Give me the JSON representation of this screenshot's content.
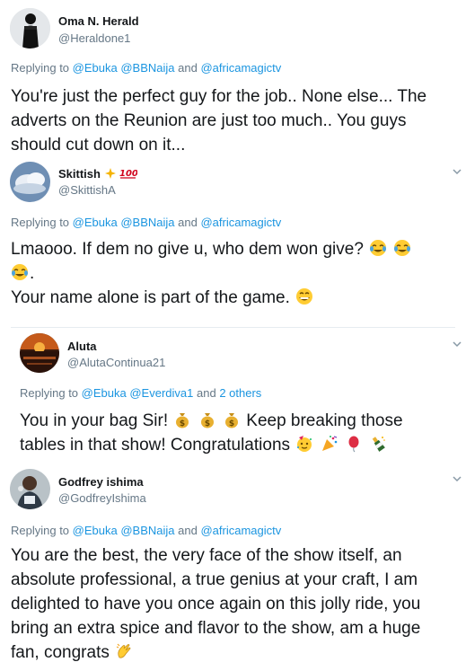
{
  "tweets": [
    {
      "name": "Oma N. Herald",
      "handle": "@Heraldone1",
      "replying_prefix": "Replying to",
      "replying_links": "@Ebuka @BBNaija",
      "replying_and": "and",
      "replying_last": "@africamagictv",
      "body_lines": [
        "You're just the perfect guy for the job.. None else... The",
        "adverts on the Reunion are just too much.. You guys",
        "should cut down on it..."
      ],
      "avatar_icon": "person-silhouette-avatar"
    },
    {
      "name": "Skittish",
      "name_emojis": [
        "sparkle-star-icon",
        "hundred-points-icon"
      ],
      "handle": "@SkittishA",
      "replying_prefix": "Replying to",
      "replying_links": "@Ebuka @BBNaija",
      "replying_and": "and",
      "replying_last": "@africamagictv",
      "body_line1": "Lmaooo.  If dem no give u, who dem won give?",
      "body_line2": ".",
      "body_line3": "Your name alone is part of the game.",
      "avatar_icon": "cloud-photo-avatar"
    },
    {
      "name": "Aluta",
      "handle": "@AlutaContinua21",
      "replying_prefix": "Replying to",
      "replying_links": "@Ebuka @Everdiva1",
      "replying_and": "and",
      "replying_last": "2 others",
      "body_line1": "You in your bag Sir!",
      "body_line1b": "Keep breaking those",
      "body_line2": "tables in that show! Congratulations",
      "avatar_icon": "sunset-photo-avatar"
    },
    {
      "name": "Godfrey ishima",
      "handle": "@GodfreyIshima",
      "replying_prefix": "Replying to",
      "replying_links": "@Ebuka @BBNaija",
      "replying_and": "and",
      "replying_last": "@africamagictv",
      "body_lines": [
        "You are the best, the very face of the show itself, an",
        "absolute professional, a true genius at your craft, I am",
        "delighted to have you once again on this jolly ride, you",
        "bring an extra spice and flavor to the show, am a huge"
      ],
      "body_last": "fan, congrats",
      "avatar_icon": "person-photo-avatar"
    }
  ],
  "colors": {
    "link": "#1b95e0",
    "secondary": "#657786",
    "text": "#14171a",
    "separator": "#e6ecf0"
  }
}
